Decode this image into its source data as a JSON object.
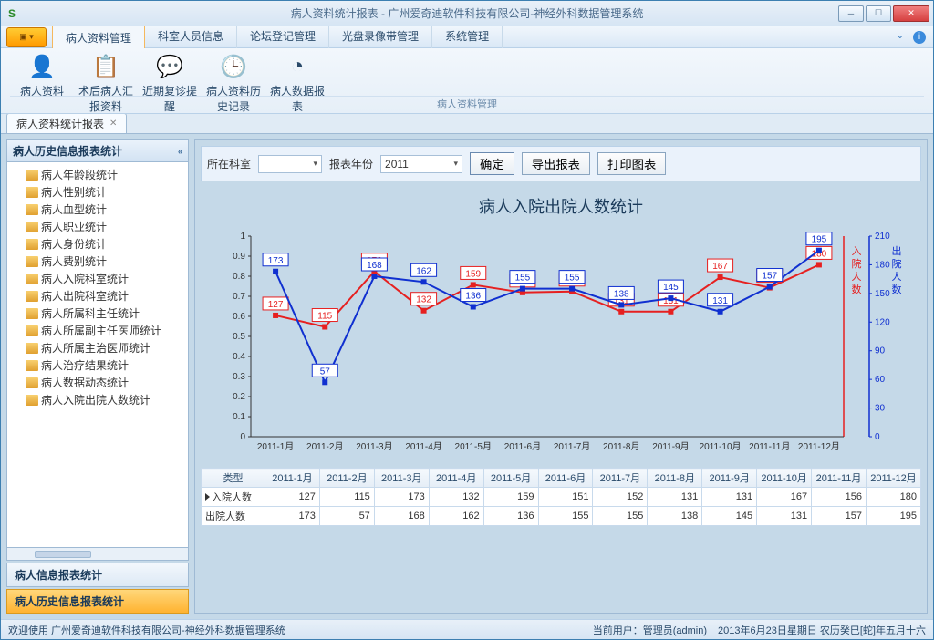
{
  "window": {
    "title": "病人资料统计报表 - 广州爱奇迪软件科技有限公司-神经外科数据管理系统"
  },
  "menu": {
    "items": [
      "病人资料管理",
      "科室人员信息",
      "论坛登记管理",
      "光盘录像带管理",
      "系统管理"
    ],
    "active_index": 0
  },
  "ribbon": {
    "group_label": "病人资料管理",
    "items": [
      {
        "label": "病人资料",
        "icon": "👤",
        "name": "patient-info"
      },
      {
        "label": "术后病人汇报资料",
        "icon": "📋",
        "name": "postop-report"
      },
      {
        "label": "近期复诊提醒",
        "icon": "💬",
        "name": "revisit-reminder"
      },
      {
        "label": "病人资料历史记录",
        "icon": "🕒",
        "name": "history-record"
      },
      {
        "label": "病人数据报表",
        "icon": "◔",
        "name": "data-report"
      }
    ]
  },
  "doc_tab": {
    "title": "病人资料统计报表"
  },
  "sidebar": {
    "header": "病人历史信息报表统计",
    "items": [
      "病人年龄段统计",
      "病人性别统计",
      "病人血型统计",
      "病人职业统计",
      "病人身份统计",
      "病人费别统计",
      "病人入院科室统计",
      "病人出院科室统计",
      "病人所属科主任统计",
      "病人所属副主任医师统计",
      "病人所属主治医师统计",
      "病人治疗结果统计",
      "病人数据动态统计",
      "病人入院出院人数统计"
    ],
    "accordion1": "病人信息报表统计",
    "accordion2": "病人历史信息报表统计"
  },
  "filters": {
    "label_dept": "所在科室",
    "dept_value": "",
    "label_year": "报表年份",
    "year_value": "2011",
    "btn_ok": "确定",
    "btn_export": "导出报表",
    "btn_print": "打印图表"
  },
  "chart_data": {
    "type": "line",
    "title": "病人入院出院人数统计",
    "categories": [
      "2011-1月",
      "2011-2月",
      "2011-3月",
      "2011-4月",
      "2011-5月",
      "2011-6月",
      "2011-7月",
      "2011-8月",
      "2011-9月",
      "2011-10月",
      "2011-11月",
      "2011-12月"
    ],
    "series": [
      {
        "name": "入院人数",
        "color": "#e62020",
        "values": [
          127,
          115,
          173,
          132,
          159,
          151,
          152,
          131,
          131,
          167,
          156,
          180
        ],
        "axis": "left",
        "ymin": 0,
        "ymax": 1
      },
      {
        "name": "出院人数",
        "color": "#1030d0",
        "values": [
          173,
          57,
          168,
          162,
          136,
          155,
          155,
          138,
          145,
          131,
          157,
          195
        ],
        "axis": "right",
        "ymin": 0,
        "ymax": 210
      }
    ],
    "left_axis_label": "入院人数",
    "right_axis_label": "出院人数",
    "left_ticks": [
      0,
      0.1,
      0.2,
      0.3,
      0.4,
      0.5,
      0.6,
      0.7,
      0.8,
      0.9,
      1
    ],
    "right_ticks": [
      0,
      30,
      60,
      90,
      120,
      150,
      180,
      210
    ]
  },
  "table": {
    "type_header": "类型",
    "row1_label": "入院人数",
    "row2_label": "出院人数"
  },
  "status": {
    "welcome": "欢迎使用 广州爱奇迪软件科技有限公司-神经外科数据管理系统",
    "user_label": "当前用户：管理员(admin)",
    "date": "2013年6月23日星期日 农历癸巳[蛇]年五月十六"
  }
}
